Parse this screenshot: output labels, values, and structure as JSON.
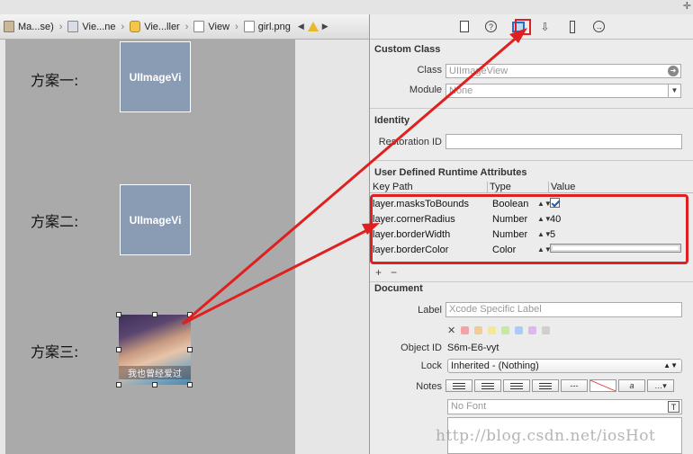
{
  "jumpbar": {
    "crumbs": [
      "Ma...se)",
      "Vie...ne",
      "Vie...ller",
      "View",
      "girl.png"
    ]
  },
  "canvas": {
    "scheme1_label": "方案一:",
    "scheme2_label": "方案二:",
    "scheme3_label": "方案三:",
    "imageview1_text": "UIImageVi",
    "imageview2_text": "UIImageVi",
    "photo_caption": "我也曾经爱过"
  },
  "inspector": {
    "custom_class": {
      "title": "Custom Class",
      "class_label": "Class",
      "class_placeholder": "UIImageView",
      "module_label": "Module",
      "module_placeholder": "None"
    },
    "identity": {
      "title": "Identity",
      "restoration_label": "Restoration ID",
      "restoration_value": ""
    },
    "runtime": {
      "title": "User Defined Runtime Attributes",
      "col_keypath": "Key Path",
      "col_type": "Type",
      "col_value": "Value",
      "rows": [
        {
          "keypath": "layer.masksToBounds",
          "type": "Boolean",
          "value": ""
        },
        {
          "keypath": "layer.cornerRadius",
          "type": "Number",
          "value": "40"
        },
        {
          "keypath": "layer.borderWidth",
          "type": "Number",
          "value": "5"
        },
        {
          "keypath": "layer.borderColor",
          "type": "Color",
          "value": ""
        }
      ],
      "add_label": "+",
      "remove_label": "−"
    },
    "document": {
      "title": "Document",
      "label_label": "Label",
      "label_placeholder": "Xcode Specific Label",
      "object_id_label": "Object ID",
      "object_id_value": "S6m-E6-vyt",
      "lock_label": "Lock",
      "lock_value": "Inherited - (Nothing)",
      "notes_label": "Notes",
      "font_placeholder": "No Font"
    }
  },
  "watermark": "http://blog.csdn.net/iosHot",
  "colors": {
    "highlight": "#e02020",
    "canvas": "#aaaaaa",
    "imageview": "#8a9cb4",
    "selected_tab": "#1a73c9"
  }
}
